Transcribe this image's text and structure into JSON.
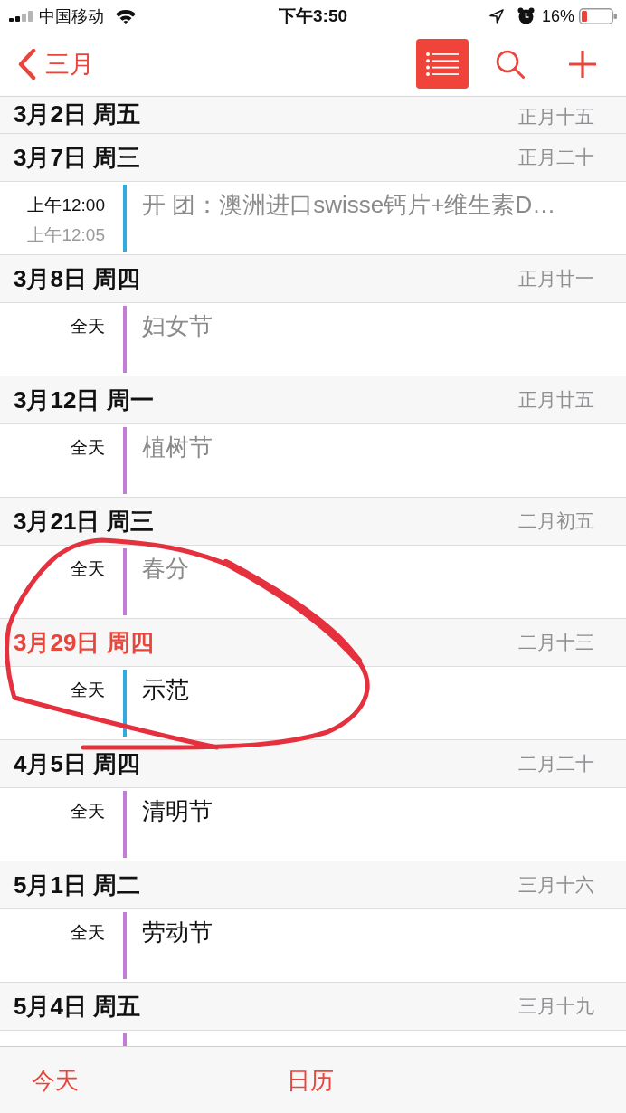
{
  "status_bar": {
    "carrier": "中国移动",
    "time": "下午3:50",
    "battery": "16%"
  },
  "nav_bar": {
    "back_label": "三月",
    "list_view_on": true
  },
  "sections": [
    {
      "date": "3月2日 周五",
      "lunar": "正月十五",
      "today": false
    },
    {
      "date": "3月7日 周三",
      "lunar": "正月二十",
      "today": false,
      "events": [
        {
          "start": "上午12:00",
          "end": "上午12:05",
          "title": "开 团：澳洲进口swisse钙片+维生素D…",
          "color": "#34aadc",
          "past": true
        }
      ]
    },
    {
      "date": "3月8日 周四",
      "lunar": "正月廿一",
      "today": false,
      "events": [
        {
          "start": "全天",
          "title": "妇女节",
          "color": "#c47dd6",
          "past": true
        }
      ]
    },
    {
      "date": "3月12日 周一",
      "lunar": "正月廿五",
      "today": false,
      "events": [
        {
          "start": "全天",
          "title": "植树节",
          "color": "#c47dd6",
          "past": true
        }
      ]
    },
    {
      "date": "3月21日 周三",
      "lunar": "二月初五",
      "today": false,
      "events": [
        {
          "start": "全天",
          "title": "春分",
          "color": "#c47dd6",
          "past": true
        }
      ]
    },
    {
      "date": "3月29日 周四",
      "lunar": "二月十三",
      "today": true,
      "events": [
        {
          "start": "全天",
          "title": "示范",
          "color": "#34aadc",
          "past": false
        }
      ]
    },
    {
      "date": "4月5日 周四",
      "lunar": "二月二十",
      "today": false,
      "events": [
        {
          "start": "全天",
          "title": "清明节",
          "color": "#c47dd6",
          "past": false
        }
      ]
    },
    {
      "date": "5月1日 周二",
      "lunar": "三月十六",
      "today": false,
      "events": [
        {
          "start": "全天",
          "title": "劳动节",
          "color": "#c47dd6",
          "past": false
        }
      ]
    },
    {
      "date": "5月4日 周五",
      "lunar": "三月十九",
      "today": false,
      "events": [
        {
          "color": "#c47dd6"
        }
      ]
    }
  ],
  "tab_bar": {
    "items": [
      "今天",
      "日历"
    ]
  }
}
